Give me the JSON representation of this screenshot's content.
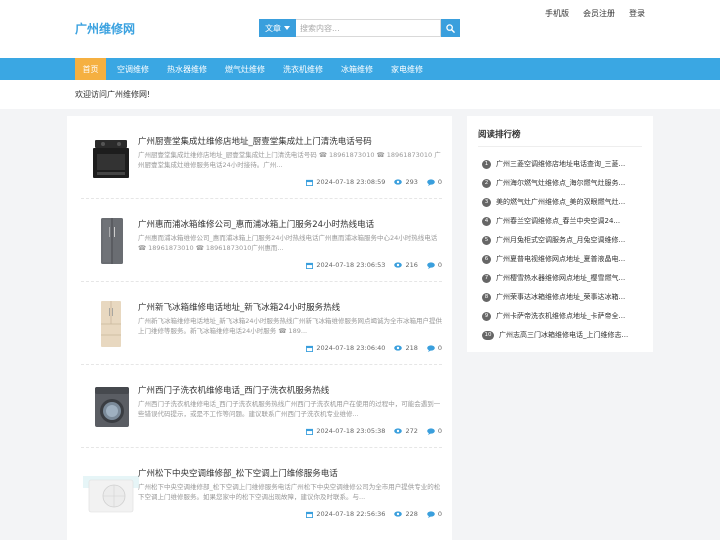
{
  "header": {
    "logo": "广州维修网",
    "search": {
      "type_label": "文章",
      "placeholder": "搜索内容..."
    },
    "top_links": [
      "手机版",
      "会员注册",
      "登录"
    ]
  },
  "nav": {
    "items": [
      "首页",
      "空调维修",
      "热水器维修",
      "燃气灶维修",
      "洗衣机维修",
      "冰箱维修",
      "家电维修"
    ],
    "active_index": 0
  },
  "welcome": "欢迎访问广州维修网!",
  "articles": [
    {
      "title": "广州厨壹堂集成灶维修店地址_厨壹堂集成灶上门清洗电话号码",
      "desc": "广州厨壹堂集成灶维修店地址_厨壹堂集成灶上门清洗电话号码 ☎ 18961873010 ☎ 18961873010 广州厨壹堂集成灶维修服务电话24小时接待。广州...",
      "date": "2024-07-18 23:08:59",
      "views": "293",
      "comments": "0",
      "image": "integrated-stove"
    },
    {
      "title": "广州惠而浦冰箱维修公司_惠而浦冰箱上门服务24小时热线电话",
      "desc": "广州惠而浦冰箱维修公司_惠而浦冰箱上门服务24小时热线电话广州惠而浦冰箱服务中心24小时热线电话 ☎ 18961873010 ☎ 18961873010广州惠而...",
      "date": "2024-07-18 23:06:53",
      "views": "216",
      "comments": "0",
      "image": "refrigerator"
    },
    {
      "title": "广州新飞冰箱维修电话地址_新飞冰箱24小时服务热线",
      "desc": "广州新飞冰箱维修电话地址_新飞冰箱24小时服务热线广州新飞冰箱维修服务网点竭诚为全市冰箱用户提供上门维修等服务。新飞冰箱维修电话24小时服务 ☎ 189...",
      "date": "2024-07-18 23:06:40",
      "views": "218",
      "comments": "0",
      "image": "french-door-fridge"
    },
    {
      "title": "广州西门子洗衣机维修电话_西门子洗衣机服务热线",
      "desc": "广州西门子洗衣机维修电话_西门子洗衣机服务热线广州西门子洗衣机用户在使用的过程中，可能会遇到一些错误代码提示，或是不工作等问题。建议联系广州西门子洗衣机专业维修...",
      "date": "2024-07-18 23:05:38",
      "views": "272",
      "comments": "0",
      "image": "washing-machine"
    },
    {
      "title": "广州松下中央空调维修部_松下空调上门维修服务电话",
      "desc": "广州松下中央空调维修部_松下空调上门维修服务电话广州松下中央空调维修公司为全市用户提供专业的松下空调上门维修服务。如果您家中的松下空调出现故障，建议你及时联系。与...",
      "date": "2024-07-18 22:56:36",
      "views": "228",
      "comments": "0",
      "image": "air-conditioner"
    }
  ],
  "sidebar": {
    "title": "阅读排行榜",
    "items": [
      {
        "num": "1",
        "text": "广州三菱空调维修店地址电话查询_三菱..."
      },
      {
        "num": "2",
        "text": "广州海尔燃气灶维修点_海尔燃气灶服务..."
      },
      {
        "num": "3",
        "text": "美的燃气灶广州维修点_美的双眼燃气灶..."
      },
      {
        "num": "4",
        "text": "广州春兰空调维修点_春兰中央空调24..."
      },
      {
        "num": "5",
        "text": "广州月兔柜式空调服务点_月兔空调维修..."
      },
      {
        "num": "6",
        "text": "广州夏普电视维修网点地址_夏普液晶电..."
      },
      {
        "num": "7",
        "text": "广州樱雪热水器维修网点地址_樱雪燃气..."
      },
      {
        "num": "8",
        "text": "广州荣事达冰箱维修点地址_荣事达冰箱..."
      },
      {
        "num": "9",
        "text": "广州卡萨帝洗衣机维修点地址_卡萨帝全..."
      },
      {
        "num": "10",
        "text": "广州志高三门冰箱维修电话_上门维修志..."
      }
    ]
  },
  "colors": {
    "brand": "#3ba2e0",
    "nav": "#3aa7e3",
    "active": "#f5b041",
    "meta_icon": "#3a9fdd"
  }
}
